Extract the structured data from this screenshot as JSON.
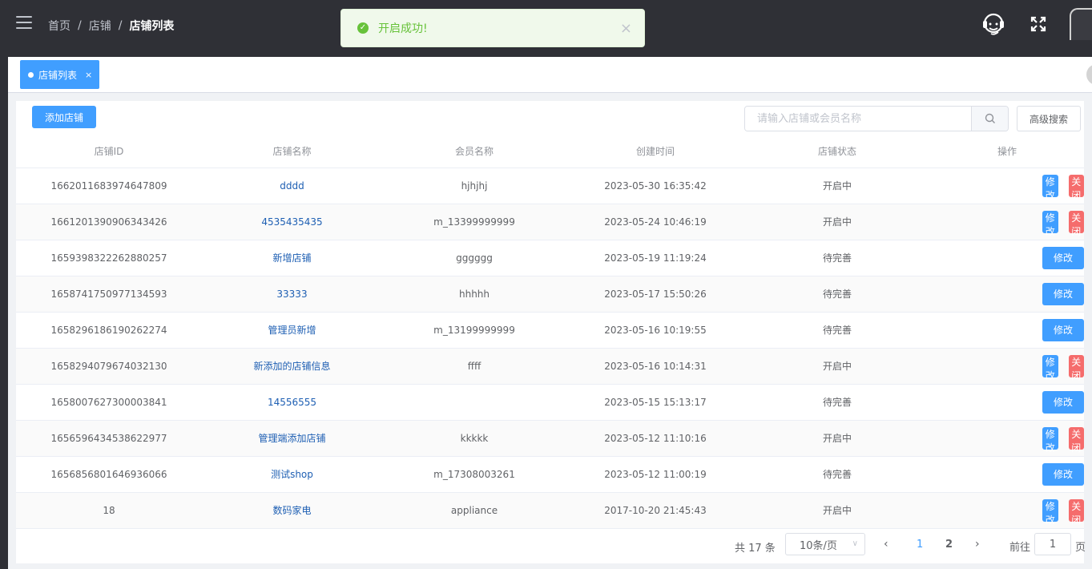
{
  "breadcrumb": {
    "home": "首页",
    "shop": "店铺",
    "current": "店铺列表",
    "sep": "/"
  },
  "toast": {
    "message": "开启成功!",
    "close": "×"
  },
  "tab": {
    "label": "店铺列表",
    "close": "×"
  },
  "toolbar": {
    "add_label": "添加店铺",
    "search_placeholder": "请输入店铺或会员名称",
    "search_value": "",
    "advanced_label": "高级搜索"
  },
  "table": {
    "headers": [
      "店铺ID",
      "店铺名称",
      "会员名称",
      "创建时间",
      "店铺状态",
      "操作"
    ],
    "edit_label": "修改",
    "close_label": "关闭",
    "rows": [
      {
        "id": "1662011683974647809",
        "name": "dddd",
        "member": "hjhjhj",
        "created": "2023-05-30 16:35:42",
        "status": "开启中",
        "closable": true
      },
      {
        "id": "1661201390906343426",
        "name": "4535435435",
        "member": "m_13399999999",
        "created": "2023-05-24 10:46:19",
        "status": "开启中",
        "closable": true
      },
      {
        "id": "1659398322262880257",
        "name": "新增店铺",
        "member": "gggggg",
        "created": "2023-05-19 11:19:24",
        "status": "待完善",
        "closable": false
      },
      {
        "id": "1658741750977134593",
        "name": "33333",
        "member": "hhhhh",
        "created": "2023-05-17 15:50:26",
        "status": "待完善",
        "closable": false
      },
      {
        "id": "1658296186190262274",
        "name": "管理员新增",
        "member": "m_13199999999",
        "created": "2023-05-16 10:19:55",
        "status": "待完善",
        "closable": false
      },
      {
        "id": "1658294079674032130",
        "name": "新添加的店铺信息",
        "member": "ffff",
        "created": "2023-05-16 10:14:31",
        "status": "开启中",
        "closable": true
      },
      {
        "id": "1658007627300003841",
        "name": "14556555",
        "member": "",
        "created": "2023-05-15 15:13:17",
        "status": "待完善",
        "closable": false
      },
      {
        "id": "1656596434538622977",
        "name": "管理端添加店铺",
        "member": "kkkkk",
        "created": "2023-05-12 11:10:16",
        "status": "开启中",
        "closable": true
      },
      {
        "id": "1656856801646936066",
        "name": "测试shop",
        "member": "m_17308003261",
        "created": "2023-05-12 11:00:19",
        "status": "待完善",
        "closable": false
      },
      {
        "id": "18",
        "name": "数码家电",
        "member": "appliance",
        "created": "2017-10-20 21:45:43",
        "status": "开启中",
        "closable": true
      }
    ]
  },
  "pagination": {
    "total_text": "共 17 条",
    "page_size": "10条/页",
    "pages": [
      "1",
      "2"
    ],
    "current_page": "1",
    "goto_prefix": "前往",
    "goto_value": "1",
    "goto_suffix": "页"
  },
  "colors": {
    "primary": "#409eff",
    "danger": "#f56c6c",
    "success": "#67c23a",
    "topbar": "#2f3036"
  }
}
